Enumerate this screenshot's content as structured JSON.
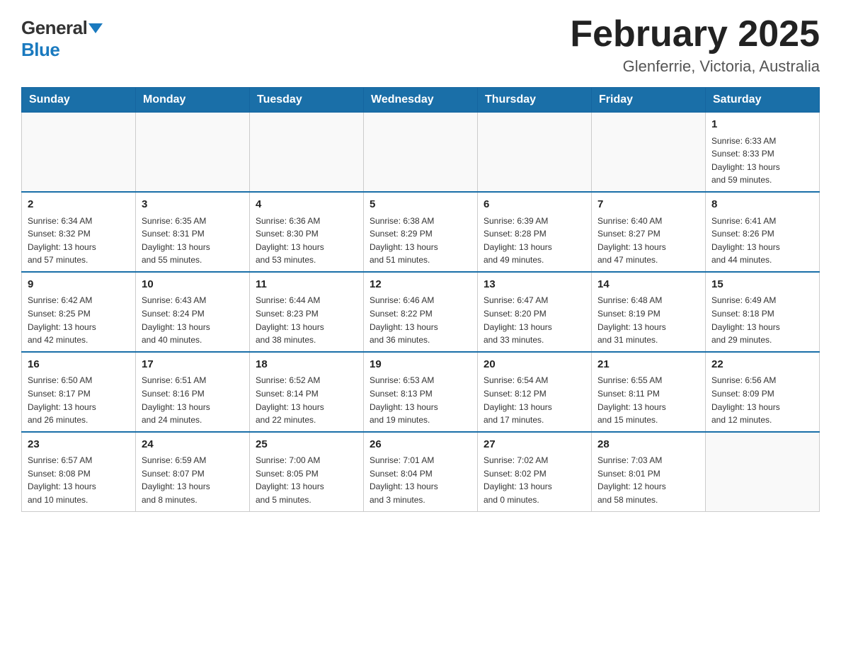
{
  "header": {
    "logo_general": "General",
    "logo_blue": "Blue",
    "title": "February 2025",
    "subtitle": "Glenferrie, Victoria, Australia"
  },
  "weekdays": [
    "Sunday",
    "Monday",
    "Tuesday",
    "Wednesday",
    "Thursday",
    "Friday",
    "Saturday"
  ],
  "weeks": [
    [
      {
        "day": "",
        "info": ""
      },
      {
        "day": "",
        "info": ""
      },
      {
        "day": "",
        "info": ""
      },
      {
        "day": "",
        "info": ""
      },
      {
        "day": "",
        "info": ""
      },
      {
        "day": "",
        "info": ""
      },
      {
        "day": "1",
        "info": "Sunrise: 6:33 AM\nSunset: 8:33 PM\nDaylight: 13 hours\nand 59 minutes."
      }
    ],
    [
      {
        "day": "2",
        "info": "Sunrise: 6:34 AM\nSunset: 8:32 PM\nDaylight: 13 hours\nand 57 minutes."
      },
      {
        "day": "3",
        "info": "Sunrise: 6:35 AM\nSunset: 8:31 PM\nDaylight: 13 hours\nand 55 minutes."
      },
      {
        "day": "4",
        "info": "Sunrise: 6:36 AM\nSunset: 8:30 PM\nDaylight: 13 hours\nand 53 minutes."
      },
      {
        "day": "5",
        "info": "Sunrise: 6:38 AM\nSunset: 8:29 PM\nDaylight: 13 hours\nand 51 minutes."
      },
      {
        "day": "6",
        "info": "Sunrise: 6:39 AM\nSunset: 8:28 PM\nDaylight: 13 hours\nand 49 minutes."
      },
      {
        "day": "7",
        "info": "Sunrise: 6:40 AM\nSunset: 8:27 PM\nDaylight: 13 hours\nand 47 minutes."
      },
      {
        "day": "8",
        "info": "Sunrise: 6:41 AM\nSunset: 8:26 PM\nDaylight: 13 hours\nand 44 minutes."
      }
    ],
    [
      {
        "day": "9",
        "info": "Sunrise: 6:42 AM\nSunset: 8:25 PM\nDaylight: 13 hours\nand 42 minutes."
      },
      {
        "day": "10",
        "info": "Sunrise: 6:43 AM\nSunset: 8:24 PM\nDaylight: 13 hours\nand 40 minutes."
      },
      {
        "day": "11",
        "info": "Sunrise: 6:44 AM\nSunset: 8:23 PM\nDaylight: 13 hours\nand 38 minutes."
      },
      {
        "day": "12",
        "info": "Sunrise: 6:46 AM\nSunset: 8:22 PM\nDaylight: 13 hours\nand 36 minutes."
      },
      {
        "day": "13",
        "info": "Sunrise: 6:47 AM\nSunset: 8:20 PM\nDaylight: 13 hours\nand 33 minutes."
      },
      {
        "day": "14",
        "info": "Sunrise: 6:48 AM\nSunset: 8:19 PM\nDaylight: 13 hours\nand 31 minutes."
      },
      {
        "day": "15",
        "info": "Sunrise: 6:49 AM\nSunset: 8:18 PM\nDaylight: 13 hours\nand 29 minutes."
      }
    ],
    [
      {
        "day": "16",
        "info": "Sunrise: 6:50 AM\nSunset: 8:17 PM\nDaylight: 13 hours\nand 26 minutes."
      },
      {
        "day": "17",
        "info": "Sunrise: 6:51 AM\nSunset: 8:16 PM\nDaylight: 13 hours\nand 24 minutes."
      },
      {
        "day": "18",
        "info": "Sunrise: 6:52 AM\nSunset: 8:14 PM\nDaylight: 13 hours\nand 22 minutes."
      },
      {
        "day": "19",
        "info": "Sunrise: 6:53 AM\nSunset: 8:13 PM\nDaylight: 13 hours\nand 19 minutes."
      },
      {
        "day": "20",
        "info": "Sunrise: 6:54 AM\nSunset: 8:12 PM\nDaylight: 13 hours\nand 17 minutes."
      },
      {
        "day": "21",
        "info": "Sunrise: 6:55 AM\nSunset: 8:11 PM\nDaylight: 13 hours\nand 15 minutes."
      },
      {
        "day": "22",
        "info": "Sunrise: 6:56 AM\nSunset: 8:09 PM\nDaylight: 13 hours\nand 12 minutes."
      }
    ],
    [
      {
        "day": "23",
        "info": "Sunrise: 6:57 AM\nSunset: 8:08 PM\nDaylight: 13 hours\nand 10 minutes."
      },
      {
        "day": "24",
        "info": "Sunrise: 6:59 AM\nSunset: 8:07 PM\nDaylight: 13 hours\nand 8 minutes."
      },
      {
        "day": "25",
        "info": "Sunrise: 7:00 AM\nSunset: 8:05 PM\nDaylight: 13 hours\nand 5 minutes."
      },
      {
        "day": "26",
        "info": "Sunrise: 7:01 AM\nSunset: 8:04 PM\nDaylight: 13 hours\nand 3 minutes."
      },
      {
        "day": "27",
        "info": "Sunrise: 7:02 AM\nSunset: 8:02 PM\nDaylight: 13 hours\nand 0 minutes."
      },
      {
        "day": "28",
        "info": "Sunrise: 7:03 AM\nSunset: 8:01 PM\nDaylight: 12 hours\nand 58 minutes."
      },
      {
        "day": "",
        "info": ""
      }
    ]
  ]
}
